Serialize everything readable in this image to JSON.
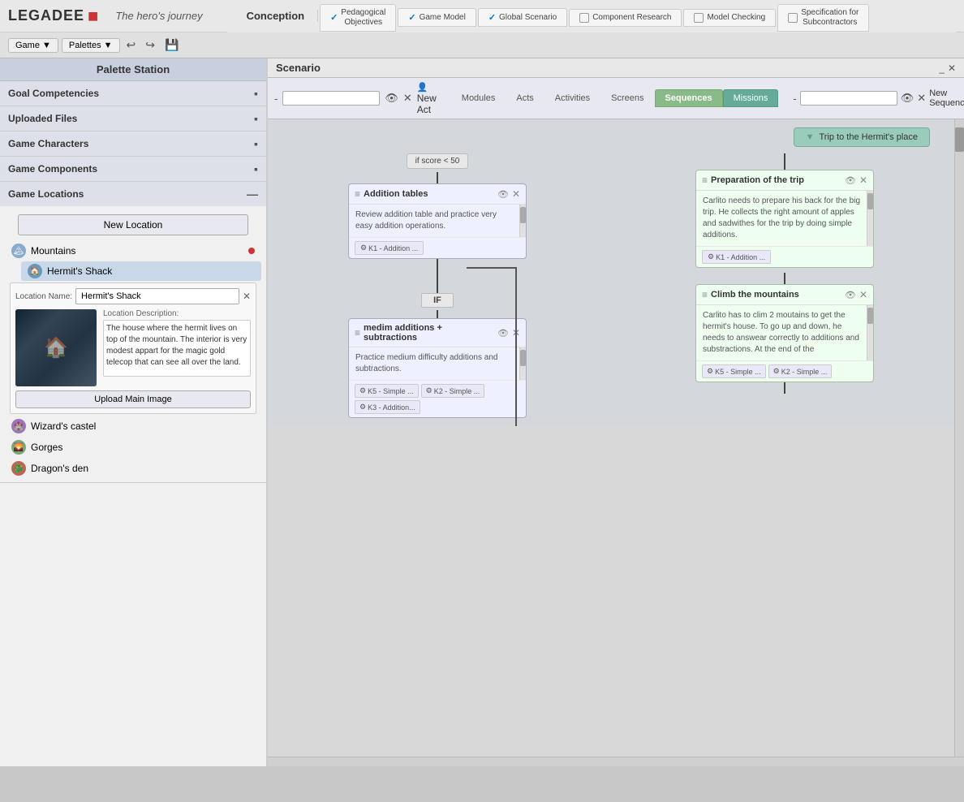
{
  "app": {
    "logo": "LEGADEE",
    "logo_dot": "■",
    "subtitle": "The hero's journey"
  },
  "nav": {
    "game_label": "Game",
    "palettes_label": "Palettes",
    "undo_icon": "↩",
    "redo_icon": "↪",
    "save_icon": "💾"
  },
  "workflow": {
    "conception_label": "Conception",
    "tabs": [
      {
        "id": "pedagogical",
        "label": "Pedagogical\nObjectives",
        "checked": true
      },
      {
        "id": "game-model",
        "label": "Game Model",
        "checked": true
      },
      {
        "id": "global-scenario",
        "label": "Global Scenario",
        "checked": true
      },
      {
        "id": "component-research",
        "label": "Component\nResearch",
        "checked": false
      },
      {
        "id": "model-checking",
        "label": "Model Checking",
        "checked": false
      },
      {
        "id": "specification",
        "label": "Specification for\nSubcontractors",
        "checked": false
      }
    ]
  },
  "palette": {
    "title": "Palette Station",
    "sections": [
      {
        "id": "goal-competencies",
        "label": "Goal Competencies",
        "expanded": false
      },
      {
        "id": "uploaded-files",
        "label": "Uploaded Files",
        "expanded": false
      },
      {
        "id": "game-characters",
        "label": "Game Characters",
        "expanded": false
      },
      {
        "id": "game-components",
        "label": "Game Components",
        "expanded": false
      },
      {
        "id": "game-locations",
        "label": "Game Locations",
        "expanded": true
      }
    ],
    "new_location_label": "New Location",
    "locations": [
      {
        "id": "mountains",
        "label": "Mountains",
        "expanded": true,
        "has_dot": true,
        "sub_locations": [
          {
            "id": "hermits-shack",
            "label": "Hermit's Shack",
            "selected": true
          }
        ]
      },
      {
        "id": "wizards-castel",
        "label": "Wizard's castel",
        "expanded": false
      },
      {
        "id": "gorges",
        "label": "Gorges",
        "expanded": false
      },
      {
        "id": "dragons-den",
        "label": "Dragon's den",
        "expanded": false
      }
    ],
    "location_form": {
      "name_label": "Location Name:",
      "name_value": "Hermit's Shack",
      "desc_label": "Location Description:",
      "desc_value": "The house where the hermit lives on top of the mountain. The interior is very modest appart for the magic gold telecop that can see all over the land.",
      "upload_label": "Upload Main Image"
    }
  },
  "scenario": {
    "title": "Scenario",
    "minimize_icon": "_",
    "close_icon": "✕",
    "toolbar": {
      "zoom_in": "-",
      "act_placeholder": "",
      "eye_icon": "👁",
      "clear_icon": "✕",
      "new_act_label": "New Act",
      "new_seq_label": "New Sequence",
      "seq_placeholder": ""
    },
    "tabs": [
      {
        "id": "modules",
        "label": "Modules",
        "active": false
      },
      {
        "id": "acts",
        "label": "Acts",
        "active": false
      },
      {
        "id": "activities",
        "label": "Activities",
        "active": false
      },
      {
        "id": "screens",
        "label": "Screens",
        "active": false
      },
      {
        "id": "sequences",
        "label": "Sequences",
        "active": true
      },
      {
        "id": "missions",
        "label": "Missions",
        "active": false
      }
    ],
    "mission": {
      "label": "Trip to the Hermit's place"
    },
    "left_column": {
      "condition": "if score < 50",
      "cards": [
        {
          "id": "addition-tables",
          "title": "Addition tables",
          "body": "Review addition table and practice very easy addition operations.",
          "tags": [
            "K1 - Addition ..."
          ],
          "icon": "≡",
          "has_scrollbar": true
        },
        {
          "id": "medium-additions",
          "title": "medim additions + subtractions",
          "body": "Practice medium difficulty additions and subtractions.",
          "tags": [
            "K5 - Simple ...",
            "K2 - Simple ...",
            "K3 - Addition..."
          ],
          "icon": "≡",
          "has_scrollbar": true,
          "if_label": "IF"
        }
      ]
    },
    "right_column": {
      "cards": [
        {
          "id": "preparation-trip",
          "title": "Preparation of the trip",
          "body": "Carlito needs to prepare his back for the big trip. He collects the right amount of apples and sadwithes for the trip by doing simple additions.",
          "tags": [
            "K1 - Addition ..."
          ],
          "icon": "≡",
          "has_scrollbar": true
        },
        {
          "id": "climb-mountains",
          "title": "Climb the mountains",
          "body": "Carlito has to clim 2 moutains to get the hermit's house. To go up and down, he needs to answear correctly to additions and substractions. At the end of the",
          "tags": [
            "K5 - Simple ...",
            "K2 - Simple ..."
          ],
          "icon": "≡",
          "has_scrollbar": true
        }
      ]
    }
  }
}
